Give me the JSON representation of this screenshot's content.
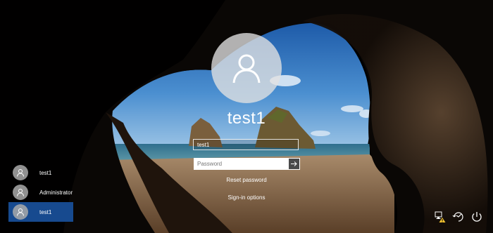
{
  "lockscreen": {
    "current_user": "test1",
    "username_value": "test1",
    "password_placeholder": "Password",
    "reset_password_label": "Reset password",
    "signin_options_label": "Sign-in options"
  },
  "user_list": [
    {
      "name": "test1",
      "selected": false
    },
    {
      "name": "Administrator",
      "selected": false
    },
    {
      "name": "test1",
      "selected": true
    }
  ],
  "system_icons": [
    "network-warning-icon",
    "ease-of-access-icon",
    "power-icon"
  ],
  "colors": {
    "selected_user_bg": "#174a8f",
    "accent": "#174a8f",
    "text": "#ffffff"
  }
}
